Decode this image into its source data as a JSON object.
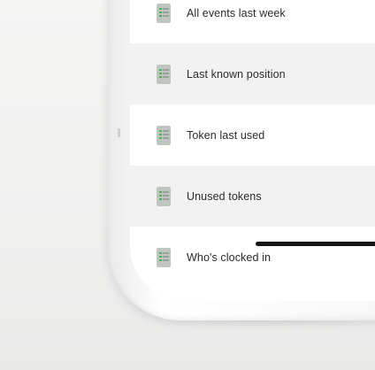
{
  "list": {
    "items": [
      {
        "label": "All events last week",
        "icon": "document-icon"
      },
      {
        "label": "Last known position",
        "icon": "document-icon"
      },
      {
        "label": "Token last used",
        "icon": "document-icon"
      },
      {
        "label": "Unused tokens",
        "icon": "document-icon"
      },
      {
        "label": "Who's clocked in",
        "icon": "document-icon"
      }
    ]
  },
  "colors": {
    "accent": "#4caf50",
    "background": "#f2f2f1",
    "row_alt": "#f2f2f2",
    "text": "#2a2a2a"
  }
}
